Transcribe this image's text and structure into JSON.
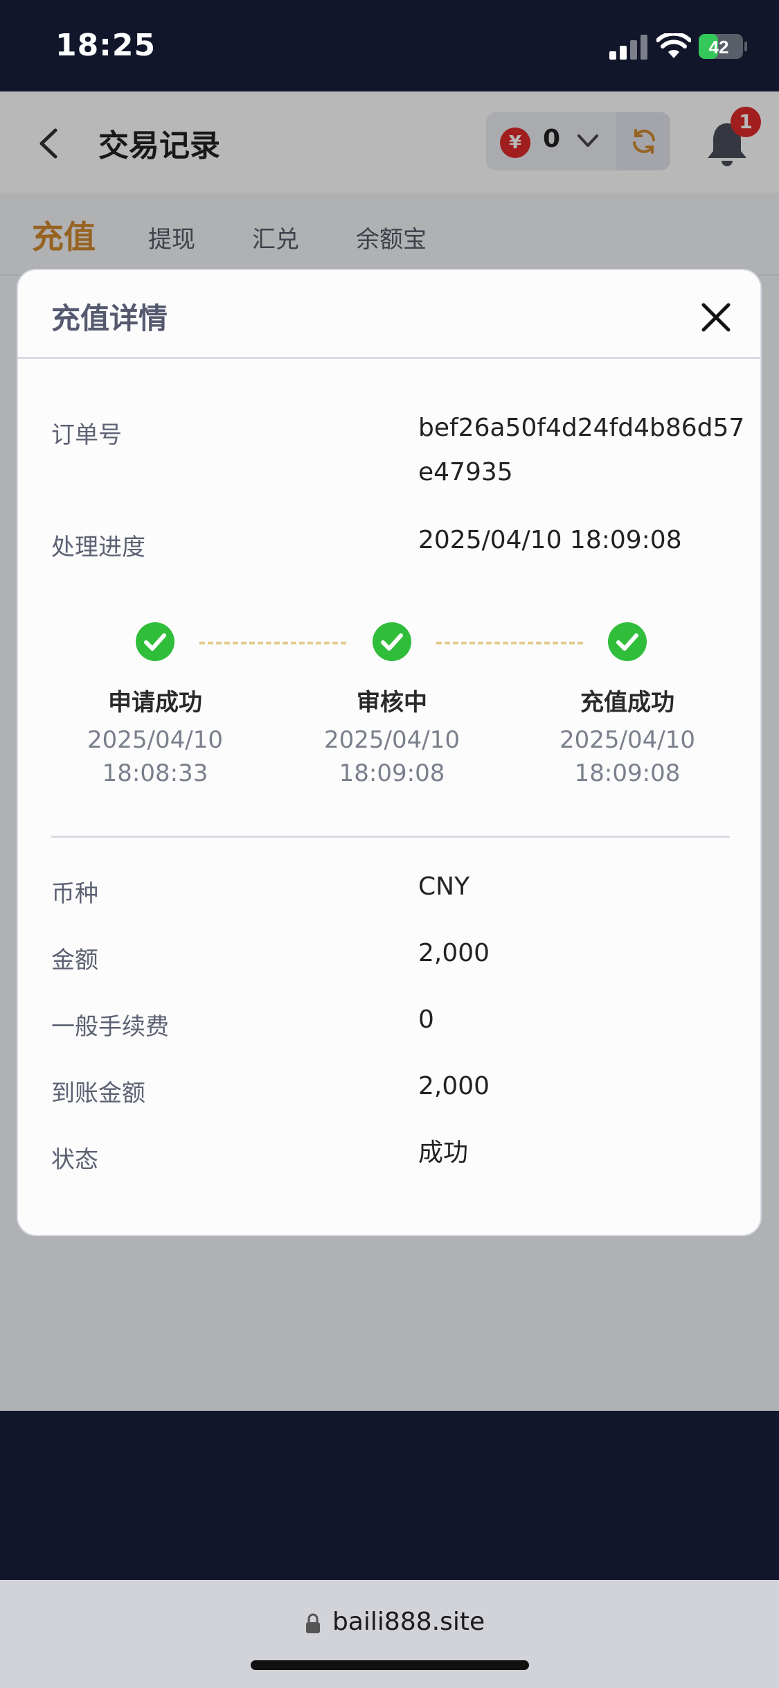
{
  "status_bar": {
    "time": "18:25",
    "battery": "42"
  },
  "app_bar": {
    "title": "交易记录",
    "balance": "0",
    "notification_count": "1"
  },
  "tabs": [
    {
      "label": "充值",
      "active": true
    },
    {
      "label": "提现",
      "active": false
    },
    {
      "label": "汇兑",
      "active": false
    },
    {
      "label": "余额宝",
      "active": false
    }
  ],
  "modal": {
    "title": "充值详情",
    "order_label": "订单号",
    "order_value": "bef26a50f4d24fd4b86d57e47935",
    "progress_label": "处理进度",
    "progress_value": "2025/04/10 18:09:08",
    "steps": [
      {
        "label": "申请成功",
        "date": "2025/04/10",
        "time": "18:08:33"
      },
      {
        "label": "审核中",
        "date": "2025/04/10",
        "time": "18:09:08"
      },
      {
        "label": "充值成功",
        "date": "2025/04/10",
        "time": "18:09:08"
      }
    ],
    "details": [
      {
        "label": "币种",
        "value": "CNY"
      },
      {
        "label": "金额",
        "value": "2,000"
      },
      {
        "label": "一般手续费",
        "value": "0"
      },
      {
        "label": "到账金额",
        "value": "2,000"
      },
      {
        "label": "状态",
        "value": "成功"
      }
    ]
  },
  "browser": {
    "url": "baili888.site"
  },
  "colors": {
    "accent": "#d08a2e",
    "success": "#2fbd3a",
    "danger": "#e02a2a"
  }
}
